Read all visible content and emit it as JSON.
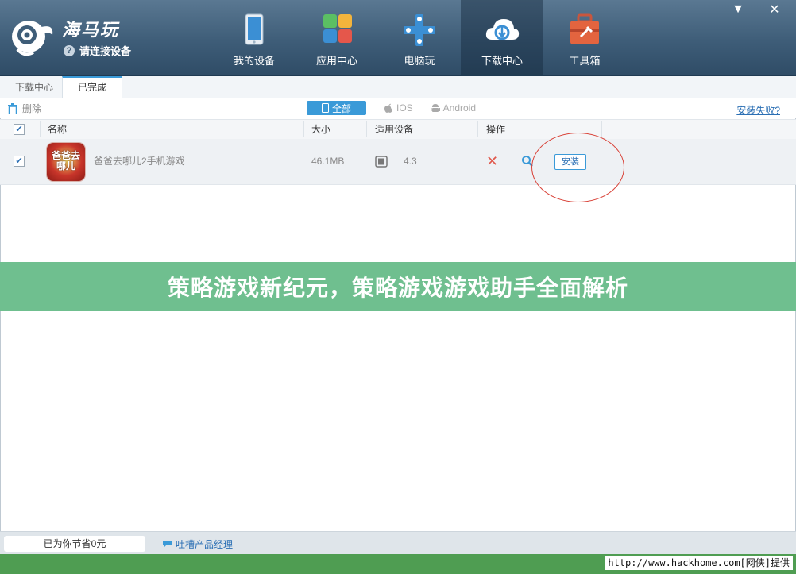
{
  "app": {
    "name": "海马玩",
    "connect_text": "请连接设备"
  },
  "nav": {
    "items": [
      {
        "label": "我的设备"
      },
      {
        "label": "应用中心"
      },
      {
        "label": "电脑玩"
      },
      {
        "label": "下载中心"
      },
      {
        "label": "工具箱"
      }
    ],
    "active": "下载中心"
  },
  "window": {
    "minimize": "▼",
    "close": "✕"
  },
  "tabs": [
    {
      "label": "下载中心"
    },
    {
      "label": "已完成"
    }
  ],
  "toolbar": {
    "delete_label": "删除",
    "filters": [
      {
        "label": "全部"
      },
      {
        "label": "IOS"
      },
      {
        "label": "Android"
      }
    ],
    "install_fail_link": "安装失败?"
  },
  "table": {
    "headers": {
      "name": "名称",
      "size": "大小",
      "device": "适用设备",
      "action": "操作"
    },
    "rows": [
      {
        "icon_text": "爸爸去哪儿",
        "name": "爸爸去哪儿2手机游戏",
        "size": "46.1MB",
        "device_version": "4.3",
        "install_label": "安装",
        "checked": true
      }
    ]
  },
  "banner": {
    "text": "策略游戏新纪元，策略游戏游戏助手全面解析"
  },
  "footer": {
    "saved_text": "已为你节省0元",
    "feedback_link": "吐槽产品经理"
  },
  "watermark": "http://www.hackhome.com[网侠]提供",
  "colors": {
    "header": "#3e5d78",
    "accent": "#3a9ad8",
    "banner": "#6fbf8f",
    "bottom_bar": "#4f9d52",
    "delete_icon": "#e05a4e"
  }
}
